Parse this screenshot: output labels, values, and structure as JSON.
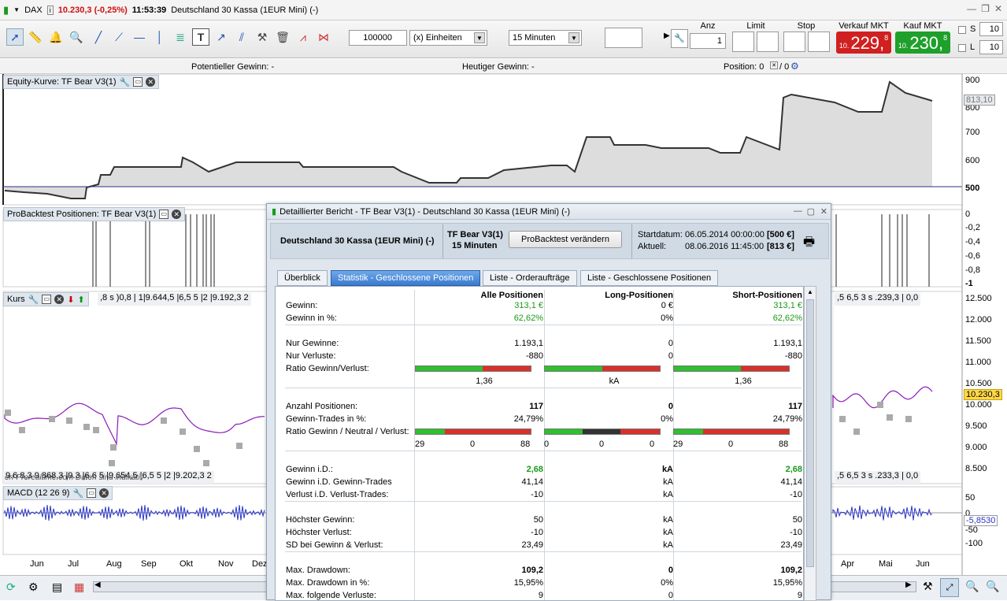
{
  "titlebar": {
    "symbol": "DAX",
    "price": "10.230,3 (-0,25%)",
    "time": "11:53:39",
    "instrument": "Deutschland 30 Kassa (1EUR Mini) (-)"
  },
  "toolbar": {
    "quantity": "100000",
    "units": "(x) Einheiten",
    "interval": "15 Minuten",
    "anz_label": "Anz",
    "anz_value": "1",
    "limit_label": "Limit",
    "stop_label": "Stop",
    "sell_label": "Verkauf MKT",
    "buy_label": "Kauf MKT",
    "sell_small": "10.",
    "sell_big": "229,",
    "sell_sup": "8",
    "buy_small": "10.",
    "buy_big": "230,",
    "buy_sup": "8",
    "s_label": "S",
    "l_label": "L",
    "s_value": "10",
    "l_value": "10"
  },
  "infobar": {
    "potential": "Potentieller Gewinn:  -",
    "today": "Heutiger Gewinn:  -",
    "position": "Position:  0",
    "position2": "/ 0"
  },
  "panels": {
    "equity": "Equity-Kurve: TF Bear V3(1)",
    "positions": "ProBacktest Positionen: TF Bear V3(1)",
    "kurs": "Kurs",
    "kurs_strip_left": ",8 s )0,8 | 1|9.644,5 |6,5 5 |2 |9.192,3 2",
    "kurs_strip_right": ",5 6,5 3 s .239,3 | 0,0",
    "kurs_bottom_left": "9.6 8,3 9.868,3 |9.3 |6.6 5 |9.654,5 |6,5 5 |2 |9.202,3 2",
    "kurs_bottom_right": ",5 6,5 3 s .233,3 | 0,0",
    "watermark": "erf Prorealtime.com Daten sind indikativ",
    "macd": "MACD (12 26 9)"
  },
  "axes": {
    "equity": [
      "900",
      "800",
      "700",
      "600",
      "500"
    ],
    "equity_badge": "813,10",
    "positions": [
      "0",
      "-0,2",
      "-0,4",
      "-0,6",
      "-0,8",
      "-1"
    ],
    "kurs": [
      "12.500",
      "12.000",
      "11.500",
      "11.000",
      "10.500",
      "10.000",
      "9.500",
      "9.000",
      "8.500"
    ],
    "kurs_badge": "10.230,3",
    "macd": [
      "50",
      "0",
      "-50",
      "-100"
    ],
    "macd_badge": "-5,8530",
    "months": [
      "Jun",
      "Jul",
      "Aug",
      "Sep",
      "Okt",
      "Nov",
      "Dez",
      "Apr",
      "Mai",
      "Jun"
    ]
  },
  "dialog": {
    "title": "Detaillierter Bericht - TF Bear V3(1) - Deutschland 30 Kassa (1EUR Mini) (-)",
    "instrument": "Deutschland 30 Kassa (1EUR Mini) (-)",
    "system": "TF Bear V3(1)",
    "timeframe": "15 Minuten",
    "modify_button": "ProBacktest verändern",
    "start_label": "Startdatum:",
    "start_value": "06.05.2014 00:00:00",
    "start_cap": "[500 €]",
    "current_label": "Aktuell:",
    "current_value": "08.06.2016 11:45:00",
    "current_cap": "[813 €]",
    "tabs": [
      "Überblick",
      "Statistik - Geschlossene Positionen",
      "Liste - Orderaufträge",
      "Liste - Geschlossene Positionen"
    ],
    "columns": [
      "Alle Positionen",
      "Long-Positionen",
      "Short-Positionen"
    ],
    "rows": [
      {
        "label": "Gewinn:",
        "v": [
          "313,1 €",
          "0 €",
          "313,1 €"
        ]
      },
      {
        "label": "Gewinn in %:",
        "v": [
          "62,62%",
          "0%",
          "62,62%"
        ]
      },
      {
        "label": "Nur Gewinne:",
        "v": [
          "1.193,1",
          "0",
          "1.193,1"
        ]
      },
      {
        "label": "Nur Verluste:",
        "v": [
          "-880",
          "0",
          "-880"
        ]
      },
      {
        "label": "Ratio Gewinn/Verlust:",
        "v": [
          "",
          "",
          ""
        ]
      },
      {
        "label": "",
        "v": [
          "1,36",
          "kA",
          "1,36"
        ]
      },
      {
        "label": "Anzahl Positionen:",
        "v": [
          "117",
          "0",
          "117"
        ]
      },
      {
        "label": "Gewinn-Trades in %:",
        "v": [
          "24,79%",
          "0%",
          "24,79%"
        ]
      },
      {
        "label": "Ratio Gewinn / Neutral / Verlust:",
        "v": [
          "",
          "",
          ""
        ]
      },
      {
        "label": "Gewinn i.D.:",
        "v": [
          "2,68",
          "kA",
          "2,68"
        ]
      },
      {
        "label": "Gewinn i.D. Gewinn-Trades",
        "v": [
          "41,14",
          "kA",
          "41,14"
        ]
      },
      {
        "label": "Verlust i.D. Verlust-Trades:",
        "v": [
          "-10",
          "kA",
          "-10"
        ]
      },
      {
        "label": "Höchster Gewinn:",
        "v": [
          "50",
          "kA",
          "50"
        ]
      },
      {
        "label": "Höchster Verlust:",
        "v": [
          "-10",
          "kA",
          "-10"
        ]
      },
      {
        "label": "SD bei Gewinn & Verlust:",
        "v": [
          "23,49",
          "kA",
          "23,49"
        ]
      },
      {
        "label": "Max. Drawdown:",
        "v": [
          "109,2",
          "0",
          "109,2"
        ]
      },
      {
        "label": "Max. Drawdown in %:",
        "v": [
          "15,95%",
          "0%",
          "15,95%"
        ]
      },
      {
        "label": "Max. folgende Verluste:",
        "v": [
          "9",
          "0",
          "9"
        ]
      }
    ],
    "gnv_counts": [
      [
        "29",
        "0",
        "88"
      ],
      [
        "0",
        "0",
        "0"
      ],
      [
        "29",
        "0",
        "88"
      ]
    ],
    "ratio_bars": [
      0.58,
      0.5,
      0.58
    ],
    "gnv_bars": [
      [
        0.25,
        0,
        0.75
      ],
      [
        0.33,
        0.33,
        0.34
      ],
      [
        0.25,
        0,
        0.75
      ]
    ]
  },
  "colors": {
    "green": "#1a9a1a",
    "red": "#d02020",
    "accent": "#3a7ad0"
  }
}
